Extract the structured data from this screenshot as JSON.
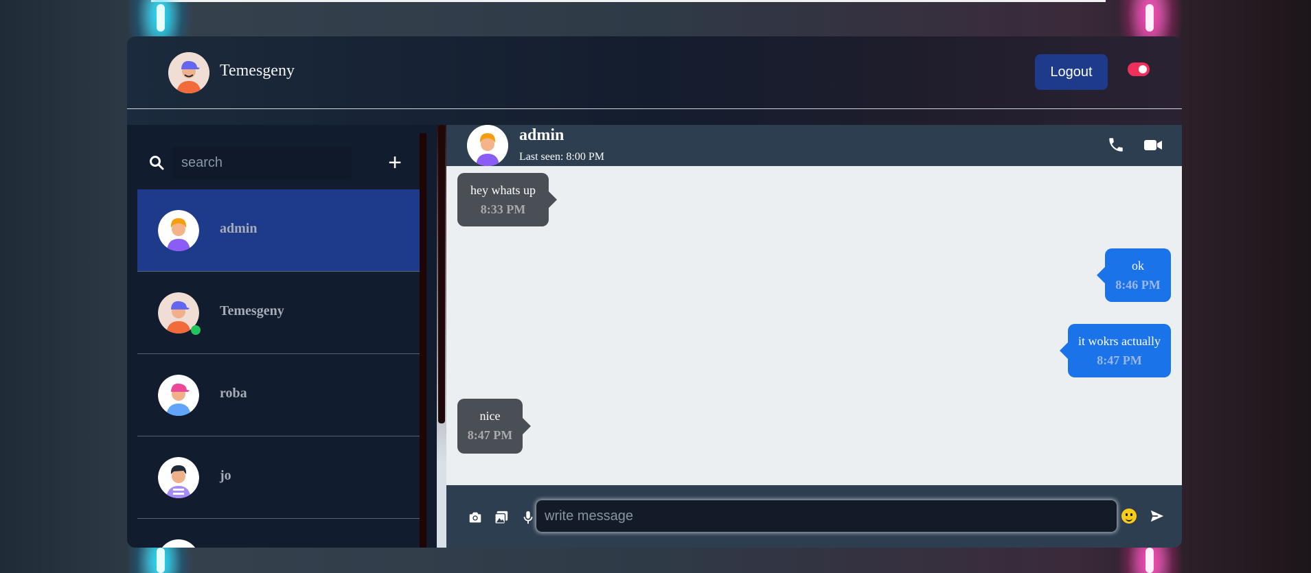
{
  "header": {
    "user_name": "Temesgeny",
    "logout_label": "Logout"
  },
  "search": {
    "placeholder": "search"
  },
  "contacts": [
    {
      "name": "admin",
      "active": true,
      "online": false
    },
    {
      "name": "Temesgeny",
      "active": false,
      "online": true
    },
    {
      "name": "roba",
      "active": false,
      "online": false
    },
    {
      "name": "jo",
      "active": false,
      "online": false
    }
  ],
  "chat": {
    "contact_name": "admin",
    "last_seen": "Last seen: 8:00 PM",
    "messages": [
      {
        "text": "hey whats up",
        "time": "8:33 PM",
        "direction": "incoming"
      },
      {
        "text": "ok",
        "time": "8:46 PM",
        "direction": "outgoing"
      },
      {
        "text": "it wokrs actually",
        "time": "8:47 PM",
        "direction": "outgoing"
      },
      {
        "text": "nice",
        "time": "8:47 PM",
        "direction": "incoming"
      }
    ]
  },
  "composer": {
    "placeholder": "write message"
  },
  "icons": {
    "search": "search-icon",
    "add": "plus-icon",
    "phone": "phone-icon",
    "video": "video-camera-icon",
    "camera": "camera-icon",
    "gallery": "gallery-icon",
    "mic": "microphone-icon",
    "emoji": "smiley-emoji-icon",
    "send": "send-icon"
  },
  "colors": {
    "accent": "#1e3a8a",
    "outgoing_bubble": "#1a73e8",
    "incoming_bubble": "#4a4e55",
    "toggle": "#f0305a",
    "online": "#22c55e"
  }
}
